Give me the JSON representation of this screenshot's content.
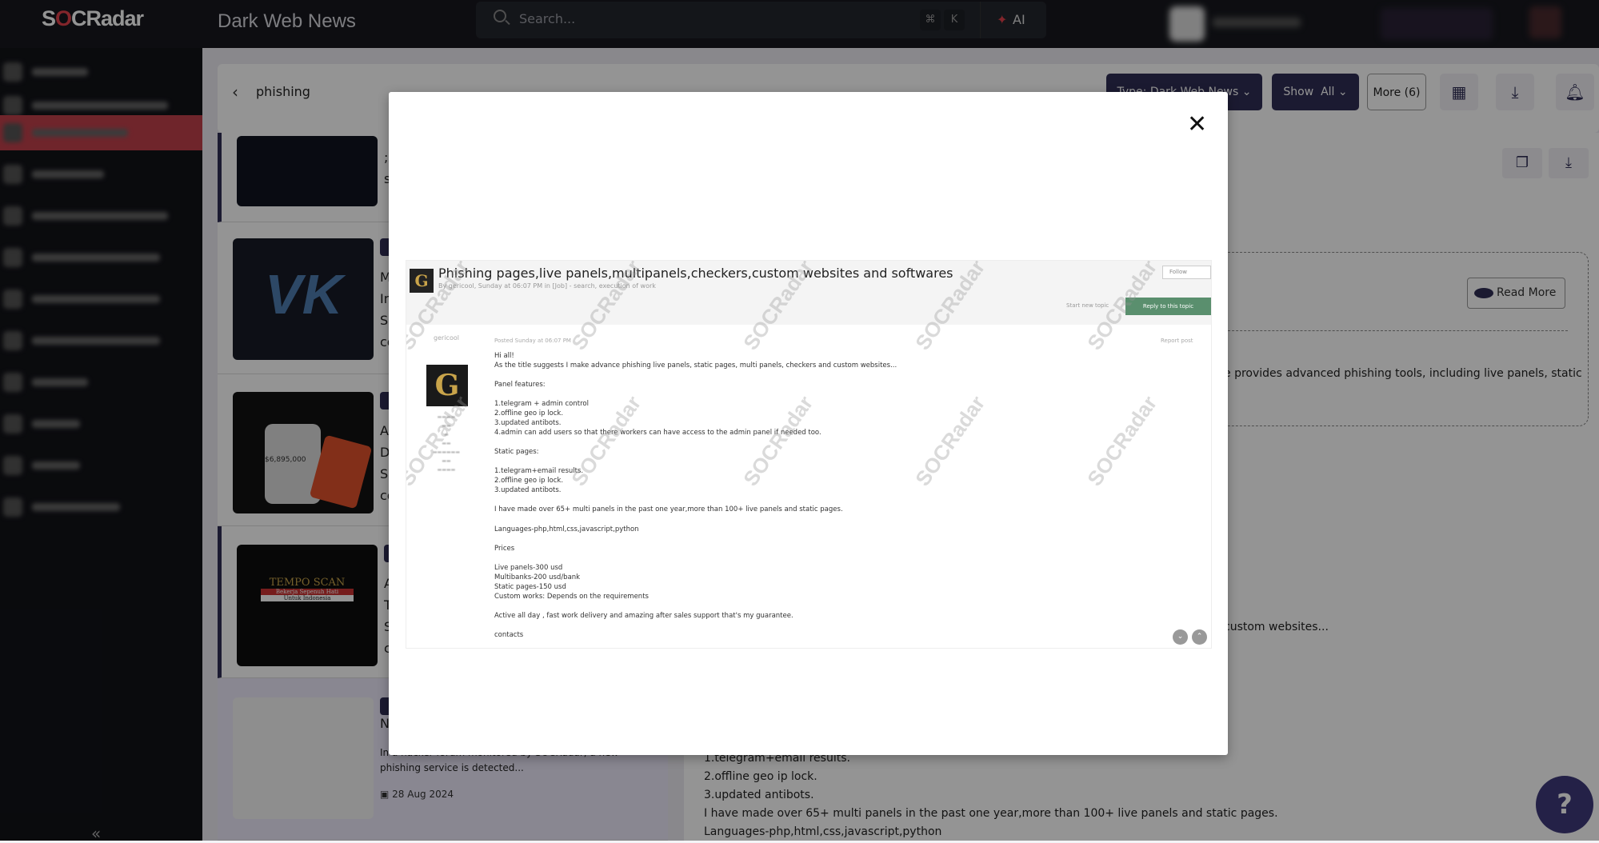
{
  "topbar": {
    "logo": "SOCRadar",
    "page_title": "Dark Web News",
    "search_placeholder": "Search...",
    "shortcut_cmd": "⌘",
    "shortcut_key": "K",
    "ai_label": "AI"
  },
  "header": {
    "breadcrumb": "phishing",
    "type_filter": "Type: Dark Web News",
    "show_label": "Show",
    "show_value": "All",
    "more_label": "More (6)"
  },
  "list": {
    "cards": [
      {
        "fragments": [
          ";In",
          "sp"
        ]
      },
      {
        "fragments": [
          "M",
          "In",
          "SO",
          "co"
        ],
        "thumb_text": "VK"
      },
      {
        "fragments": [
          "A",
          "D",
          "SO",
          "co"
        ],
        "thumb_text": "$6,895,000"
      },
      {
        "fragments": [
          "A",
          "Te",
          "SO",
          "co"
        ],
        "thumb_text": "TEMPO SCAN",
        "thumb_sub": "Bekerja Sepenuh Hati",
        "thumb_sub2": "Untuk Indonesia"
      },
      {
        "fragments": [
          "N"
        ],
        "description": "In a hacker forum monitored by SOCRadar, a new phishing service is detected...",
        "date": "28 Aug 2024"
      }
    ]
  },
  "detail": {
    "read_more": "Read More",
    "summary_fragment": "e provides advanced phishing tools, including live panels, static",
    "excerpt_fragment": "custom websites...",
    "body_lines": [
      "1.telegram+email results.",
      "2.offline geo ip lock.",
      "3.updated antibots.",
      "I have made over 65+ multi panels in the past one year,more than 100+ live panels and static pages.",
      "Languages-php,html,css,javascript,python"
    ]
  },
  "modal": {
    "post_title": "Phishing pages,live panels,multipanels,checkers,custom websites and softwares",
    "post_meta": "By gericool, Sunday at 06:07 PM in [Job] - search, execution of work",
    "follow": "Follow",
    "start_new_topic": "Start new topic",
    "reply": "Reply to this topic",
    "username": "gericool",
    "posted": "Posted Sunday at 06:07 PM",
    "report": "Report post",
    "watermark": "SOCRadar",
    "paragraphs": [
      [
        "Hi all!",
        "As the title suggests I make advance phishing live panels, static pages, multi panels, checkers and custom websites..."
      ],
      [
        "Panel features:"
      ],
      [
        "1.telegram + admin control",
        "2.offline geo ip lock.",
        "3.updated antibots.",
        "4.admin can add users so that there workers can have access to the admin panel if needed too."
      ],
      [
        "Static pages:"
      ],
      [
        "1.telegram+email results.",
        "2.offline geo ip lock.",
        "3.updated antibots."
      ],
      [
        "I have made over 65+ multi panels in the past one year,more than 100+ live panels and static pages."
      ],
      [
        "Languages-php,html,css,javascript,python"
      ],
      [
        "Prices"
      ],
      [
        "Live panels-300 usd",
        "Multibanks-200 usd/bank",
        "Static pages-150 usd",
        "Custom works: Depends on the requirements"
      ],
      [
        "Active all day , fast work delivery and amazing after sales support that's my guarantee."
      ],
      [
        "contacts"
      ]
    ]
  },
  "colors": {
    "accent": "#e0414b",
    "brand_dark": "#2f2d55",
    "reply_green": "#5a8f6e"
  }
}
